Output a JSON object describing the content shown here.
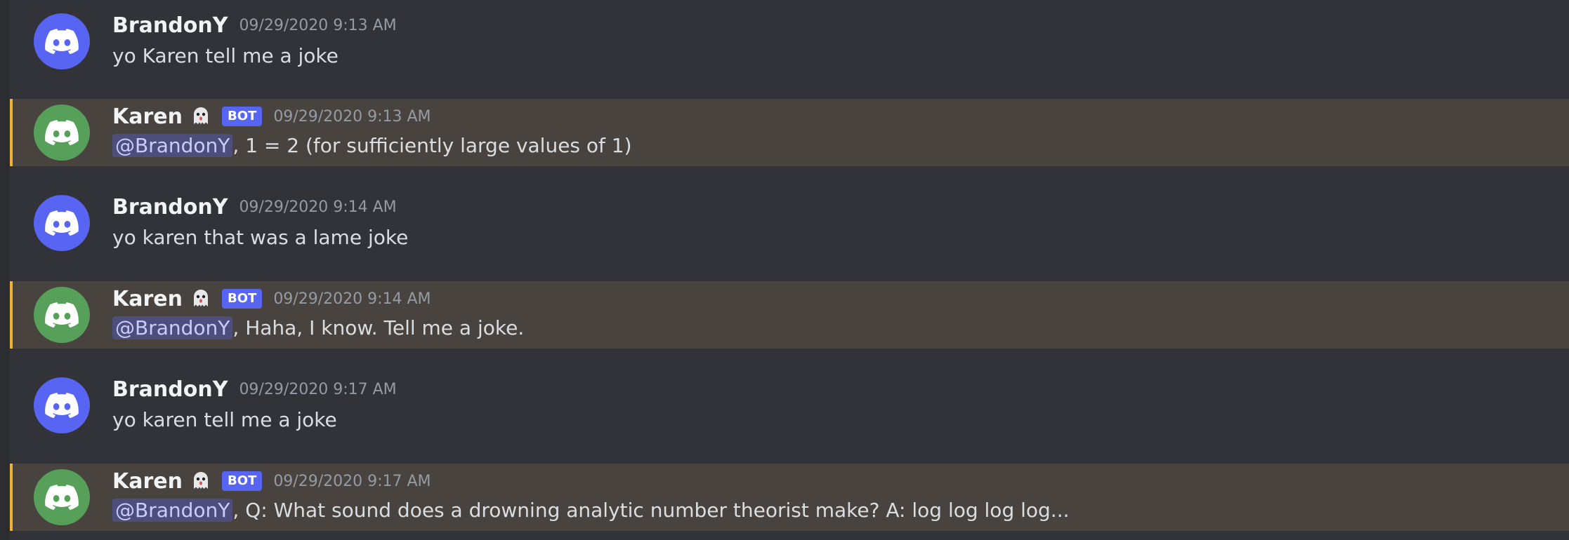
{
  "messages": [
    {
      "author": "BrandonY",
      "is_bot": false,
      "bot_tag": "",
      "timestamp": "09/29/2020 9:13 AM",
      "mention": "",
      "text": "yo Karen tell me a joke",
      "avatar_color": "#5865f2"
    },
    {
      "author": "Karen",
      "is_bot": true,
      "bot_tag": "BOT",
      "timestamp": "09/29/2020 9:13 AM",
      "mention": "@BrandonY",
      "text": ", 1 = 2 (for sufficiently large values of 1)",
      "avatar_color": "#57a05a"
    },
    {
      "author": "BrandonY",
      "is_bot": false,
      "bot_tag": "",
      "timestamp": "09/29/2020 9:14 AM",
      "mention": "",
      "text": "yo karen that was a lame joke",
      "avatar_color": "#5865f2"
    },
    {
      "author": "Karen",
      "is_bot": true,
      "bot_tag": "BOT",
      "timestamp": "09/29/2020 9:14 AM",
      "mention": "@BrandonY",
      "text": ", Haha, I know. Tell me a joke.",
      "avatar_color": "#57a05a"
    },
    {
      "author": "BrandonY",
      "is_bot": false,
      "bot_tag": "",
      "timestamp": "09/29/2020 9:17 AM",
      "mention": "",
      "text": "yo karen tell me a joke",
      "avatar_color": "#5865f2"
    },
    {
      "author": "Karen",
      "is_bot": true,
      "bot_tag": "BOT",
      "timestamp": "09/29/2020 9:17 AM",
      "mention": "@BrandonY",
      "text": ", Q: What sound does a drowning analytic number theorist make? A: log log log log...",
      "avatar_color": "#57a05a"
    }
  ],
  "icons": {
    "avatar": "discord-logo-icon",
    "bot_emoji": "ghost-icon"
  },
  "colors": {
    "background": "#313338",
    "mention_highlight": "#48433e",
    "mention_bar": "#f0b232",
    "bot_tag": "#5865f2"
  }
}
